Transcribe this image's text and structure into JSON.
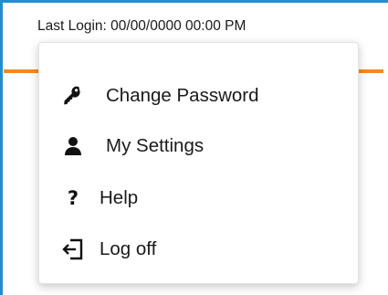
{
  "header": {
    "last_login": "Last Login: 00/00/0000 00:00 PM"
  },
  "menu": {
    "items": [
      {
        "label": "Change Password",
        "icon": "key-icon"
      },
      {
        "label": "My Settings",
        "icon": "user-icon"
      },
      {
        "label": "Help",
        "icon": "question-mark-icon",
        "glyph": "?"
      },
      {
        "label": "Log off",
        "icon": "log-off-icon"
      }
    ]
  },
  "colors": {
    "frame_border": "#1f8fcf",
    "accent_bar": "#f08a24",
    "text": "#1a1a1a"
  }
}
